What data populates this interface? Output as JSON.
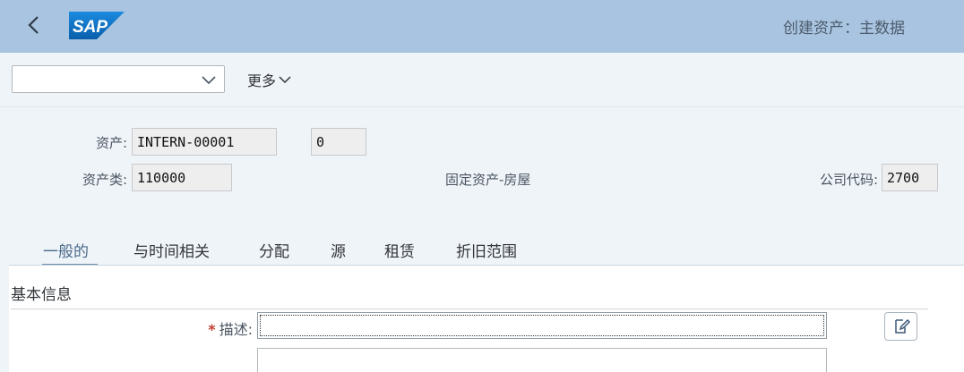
{
  "shell": {
    "title": "创建资产：主数据",
    "logo_text": "SAP",
    "back_icon": "chevron-left-icon"
  },
  "toolbar": {
    "select_value": "",
    "more_label": "更多"
  },
  "header": {
    "asset_label": "资产:",
    "asset_value": "INTERN-00001",
    "subnumber_value": "0",
    "asset_class_label": "资产类:",
    "asset_class_value": "110000",
    "asset_class_desc": "固定资产-房屋",
    "company_code_label": "公司代码:",
    "company_code_value": "2700"
  },
  "tabs": [
    {
      "label": "一般的",
      "active": true
    },
    {
      "label": "与时间相关",
      "active": false
    },
    {
      "label": "分配",
      "active": false
    },
    {
      "label": "源",
      "active": false
    },
    {
      "label": "租赁",
      "active": false
    },
    {
      "label": "折旧范围",
      "active": false
    }
  ],
  "content": {
    "section_title": "基本信息",
    "description_label": "描述:",
    "required_mark": "*",
    "description_value": "",
    "description2_value": ""
  },
  "colors": {
    "shell_bg": "#a9c4e0",
    "page_bg": "#eff4f9",
    "sap_blue": "#0f6fc2",
    "required": "#c33a2b",
    "active_tab": "#6f8eaf"
  }
}
